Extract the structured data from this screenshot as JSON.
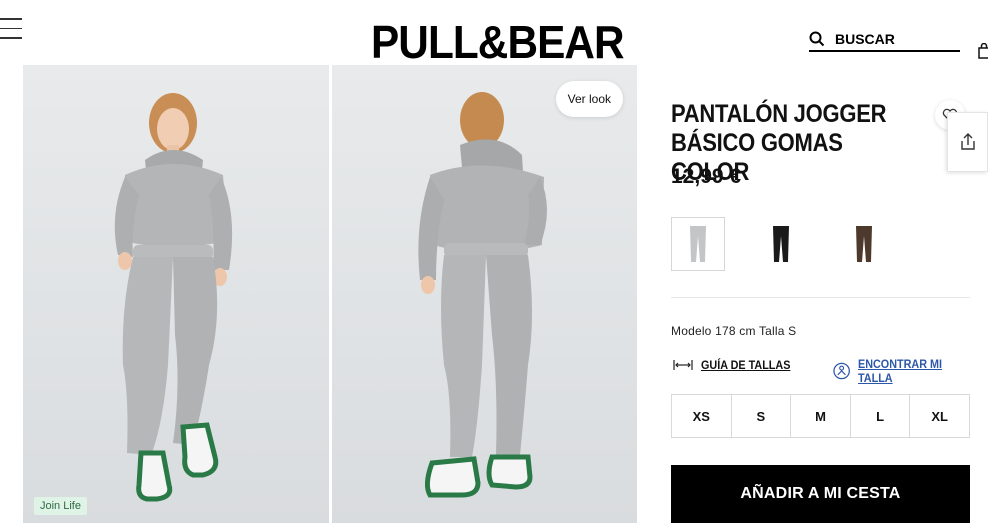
{
  "header": {
    "logo": "PULL&BEAR",
    "search_placeholder": "BUSCAR"
  },
  "gallery": {
    "badge": "Join Life",
    "ver_look": "Ver look"
  },
  "product": {
    "title_line1": "PANTALÓN JOGGER",
    "title_line2": "BÁSICO GOMAS COLOR",
    "price": "12,99 €",
    "colors": [
      {
        "name": "grey",
        "hex": "#b9bcbf",
        "selected": true
      },
      {
        "name": "black",
        "hex": "#1a1a1a",
        "selected": false
      },
      {
        "name": "brown",
        "hex": "#4e3a2c",
        "selected": false
      }
    ],
    "model_info": "Modelo 178 cm Talla S",
    "size_guide": "GUÍA DE TALLAS",
    "find_size": "ENCONTRAR MI TALLA",
    "sizes": [
      "XS",
      "S",
      "M",
      "L",
      "XL"
    ],
    "add_to_cart": "AÑADIR A MI CESTA"
  },
  "colors": {
    "accent_link": "#2c57a8",
    "join_life_bg": "#dff3e6",
    "join_life_text": "#2f6a45"
  }
}
